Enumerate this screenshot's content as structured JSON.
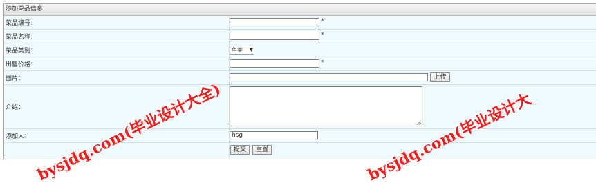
{
  "form": {
    "title": "添加菜品信息",
    "rows": [
      {
        "label": "菜品编号：",
        "value": "",
        "required_mark": "*"
      },
      {
        "label": "菜品名称：",
        "value": "",
        "required_mark": "*"
      },
      {
        "label": "菜品类别：",
        "select_value": "鱼类"
      },
      {
        "label": "出售价格：",
        "value": "",
        "required_mark": "*"
      },
      {
        "label": "图片：",
        "value": "",
        "upload_button": "上传"
      },
      {
        "label": "介绍：",
        "value": ""
      },
      {
        "label": "添加人：",
        "value": "hsg"
      }
    ],
    "submit_label": "提交",
    "reset_label": "重置"
  },
  "watermark": {
    "text_left": "bysjdq.com(毕业设计大全)",
    "text_right": "bysjdq.com(毕业设计大",
    "color": "#ff0000"
  }
}
